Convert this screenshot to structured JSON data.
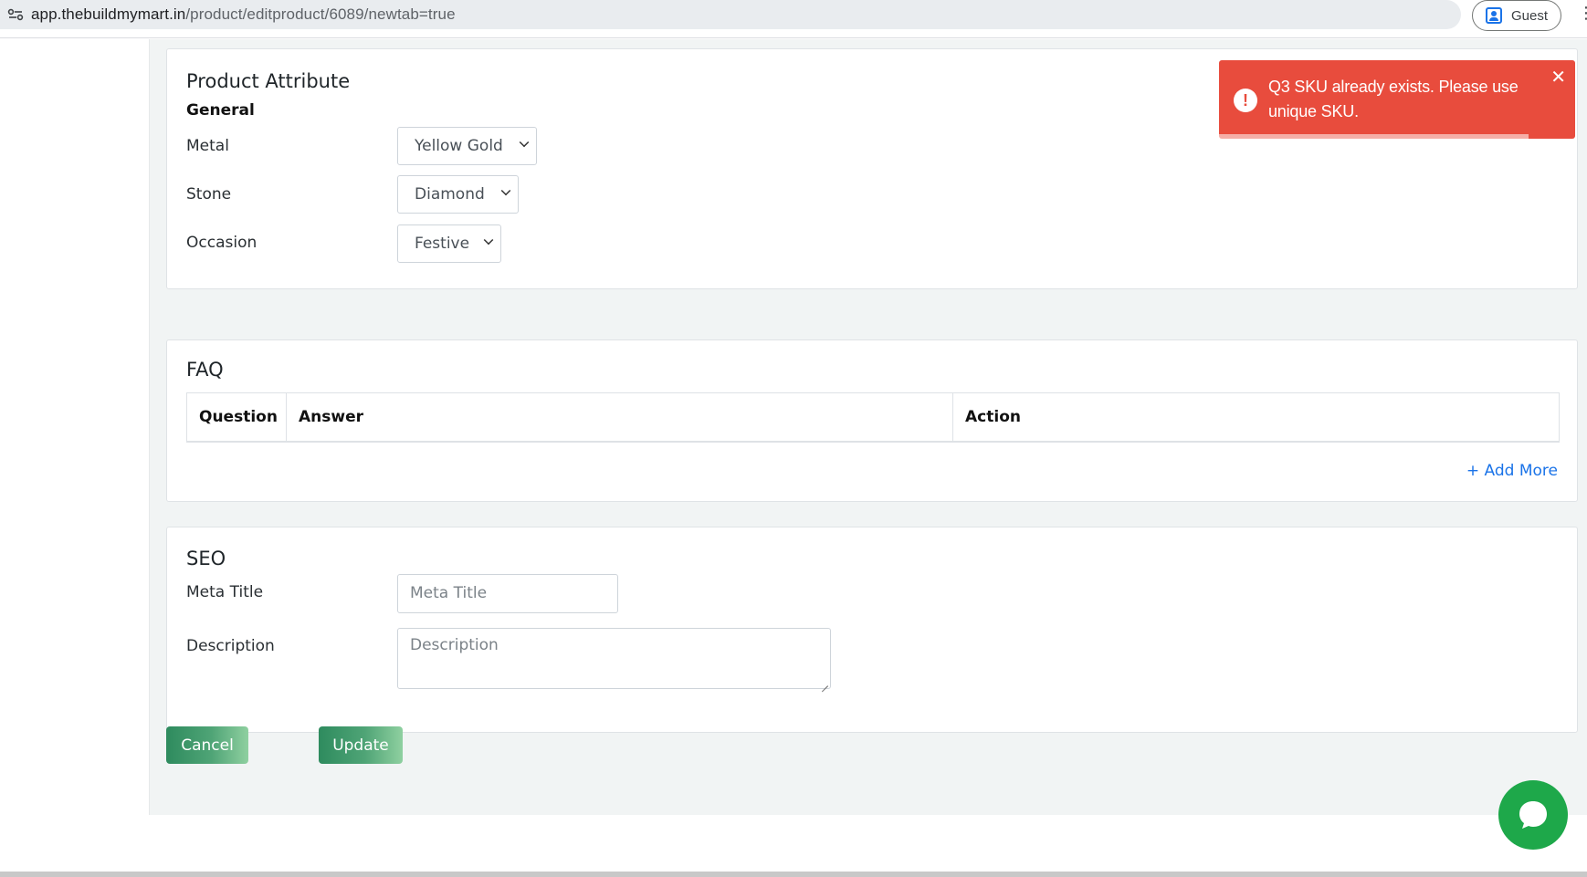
{
  "browser": {
    "url_host": "app.thebuildmymart.in",
    "url_path": "/product/editproduct/6089/newtab=true",
    "profile_label": "Guest"
  },
  "product_attribute": {
    "title": "Product Attribute",
    "subheading": "General",
    "fields": [
      {
        "label": "Metal",
        "value": "Yellow Gold"
      },
      {
        "label": "Stone",
        "value": "Diamond"
      },
      {
        "label": "Occasion",
        "value": "Festive"
      }
    ]
  },
  "faq": {
    "title": "FAQ",
    "columns": [
      "Question",
      "Answer",
      "Action"
    ],
    "add_more_label": "+ Add More"
  },
  "seo": {
    "title": "SEO",
    "meta_title_label": "Meta Title",
    "meta_title_placeholder": "Meta Title",
    "description_label": "Description",
    "description_placeholder": "Description"
  },
  "actions": {
    "cancel_label": "Cancel",
    "update_label": "Update"
  },
  "toast": {
    "message": "Q3 SKU already exists. Please use unique SKU.",
    "icon": "exclamation-icon",
    "progress": 0.87,
    "color": "#e84c3d"
  },
  "colors": {
    "accent_green": "#2e8b5e",
    "link_blue": "#1a73e8",
    "chat_green": "#1ea84a"
  }
}
